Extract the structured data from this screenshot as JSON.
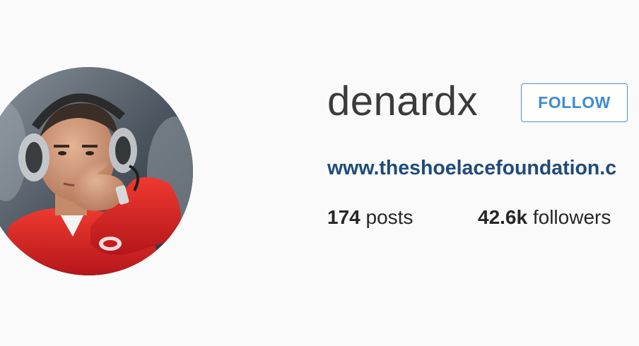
{
  "profile": {
    "username": "denardx",
    "follow_label": "FOLLOW",
    "website": "www.theshoelacefoundation.c",
    "stats": {
      "posts_count": "174",
      "posts_label": "posts",
      "followers_count": "42.6k",
      "followers_label": "followers"
    }
  },
  "colors": {
    "background": "#fafafa",
    "follow_blue": "#3f8bd3",
    "link_blue": "#1f4b79",
    "text_dark": "#262626",
    "jacket_red": "#d8231f"
  }
}
